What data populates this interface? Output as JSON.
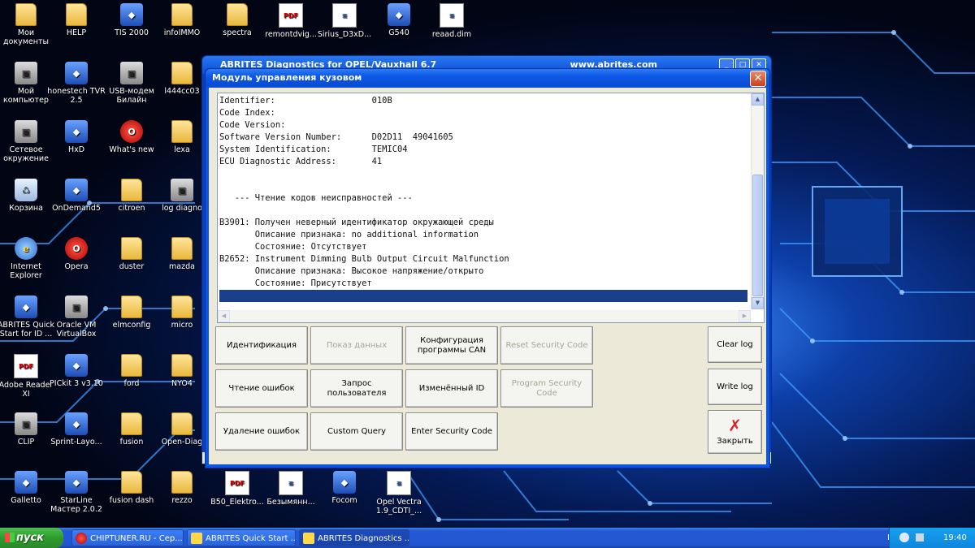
{
  "desktop": {
    "icons": [
      {
        "label": "Мои документы",
        "kind": "folder"
      },
      {
        "label": "HELP",
        "kind": "folder"
      },
      {
        "label": "TIS 2000",
        "kind": "app"
      },
      {
        "label": "infoIMMO",
        "kind": "folder"
      },
      {
        "label": "spectra",
        "kind": "folder"
      },
      {
        "label": "remontdvig...",
        "kind": "pdf"
      },
      {
        "label": "Sirius_D3xD...",
        "kind": "doc"
      },
      {
        "label": "G540",
        "kind": "app"
      },
      {
        "label": "reaad.dim",
        "kind": "doc"
      },
      {
        "label": "Мой компьютер",
        "kind": "gray"
      },
      {
        "label": "honestech TVR 2.5",
        "kind": "app"
      },
      {
        "label": "USB-модем Билайн",
        "kind": "gray"
      },
      {
        "label": "l444cc03",
        "kind": "folder"
      },
      {
        "label": "Сетевое окружение",
        "kind": "gray"
      },
      {
        "label": "HxD",
        "kind": "app"
      },
      {
        "label": "What's new",
        "kind": "red"
      },
      {
        "label": "lexa",
        "kind": "folder"
      },
      {
        "label": "Корзина",
        "kind": "bin"
      },
      {
        "label": "OnDemand5",
        "kind": "app"
      },
      {
        "label": "citroen",
        "kind": "folder"
      },
      {
        "label": "log diagno",
        "kind": "gray"
      },
      {
        "label": "Internet Explorer",
        "kind": "ie"
      },
      {
        "label": "Opera",
        "kind": "red"
      },
      {
        "label": "duster",
        "kind": "folder"
      },
      {
        "label": "mazda",
        "kind": "folder"
      },
      {
        "label": "ABRITES Quick Start for ID ...",
        "kind": "app"
      },
      {
        "label": "Oracle VM VirtualBox",
        "kind": "gray"
      },
      {
        "label": "elmconfig",
        "kind": "folder"
      },
      {
        "label": "micro",
        "kind": "folder"
      },
      {
        "label": "Adobe Reader XI",
        "kind": "pdf"
      },
      {
        "label": "PICkit 3 v3.10",
        "kind": "app"
      },
      {
        "label": "ford",
        "kind": "folder"
      },
      {
        "label": "NYO4",
        "kind": "folder"
      },
      {
        "label": "CLIP",
        "kind": "gray"
      },
      {
        "label": "Sprint-Layo...",
        "kind": "app"
      },
      {
        "label": "fusion",
        "kind": "folder"
      },
      {
        "label": "Open-Diag",
        "kind": "folder"
      },
      {
        "label": "Galletto",
        "kind": "app"
      },
      {
        "label": "StarLine Мастер 2.0.2",
        "kind": "app"
      },
      {
        "label": "fusion dash",
        "kind": "folder"
      },
      {
        "label": "rezzo",
        "kind": "folder"
      },
      {
        "label": "B50_Elektro...",
        "kind": "pdf"
      },
      {
        "label": "Безымянн...",
        "kind": "doc"
      },
      {
        "label": "Focom",
        "kind": "app"
      },
      {
        "label": "Opel Vectra 1.9_CDTI_...",
        "kind": "doc"
      }
    ]
  },
  "bg_window": {
    "title": "ABRITES Diagnostics for OPEL/Vauxhall 6.7",
    "url": "www.abrites.com"
  },
  "dialog": {
    "title": "Модуль управления кузовом",
    "close": "✕",
    "log_lines": [
      "Identifier:                   010B",
      "Code Index:",
      "Code Version:",
      "Software Version Number:      D02D11  49041605",
      "System Identification:        TEMIC04",
      "ECU Diagnostic Address:       41",
      "",
      "",
      "   --- Чтение кодов неисправностей ---",
      "",
      "B3901: Получен неверный идентификатор окружающей среды",
      "       Описание признака: no additional information",
      "       Состояние: Отсутствует",
      "B2652: Instrument Dimming Bulb Output Circuit Malfunction",
      "       Описание признака: Высокое напряжение/открыто",
      "       Состояние: Присутствует",
      ""
    ],
    "buttons": {
      "identification": "Идентификация",
      "show_data": "Показ данных",
      "can_config": "Конфигурация программы CAN",
      "reset_security": "Reset Security Code",
      "read_errors": "Чтение ошибок",
      "user_query": "Запрос пользователя",
      "changed_id": "Изменённый ID",
      "program_security": "Program Security Code",
      "delete_errors": "Удаление ошибок",
      "custom_query": "Custom Query",
      "enter_security": "Enter Security Code",
      "clear_log": "Clear log",
      "write_log": "Write log",
      "close": "Закрыть"
    }
  },
  "taskbar": {
    "start": "пуск",
    "tasks": [
      {
        "label": "CHIPTUNER.RU - Сер..."
      },
      {
        "label": "ABRITES Quick Start ..."
      },
      {
        "label": "ABRITES Diagnostics ..."
      }
    ],
    "lang": "EN",
    "clock": "19:40"
  },
  "colors": {
    "accent": "#0b55e2",
    "selection": "#1b3f8a",
    "start": "#2e9a2e"
  }
}
